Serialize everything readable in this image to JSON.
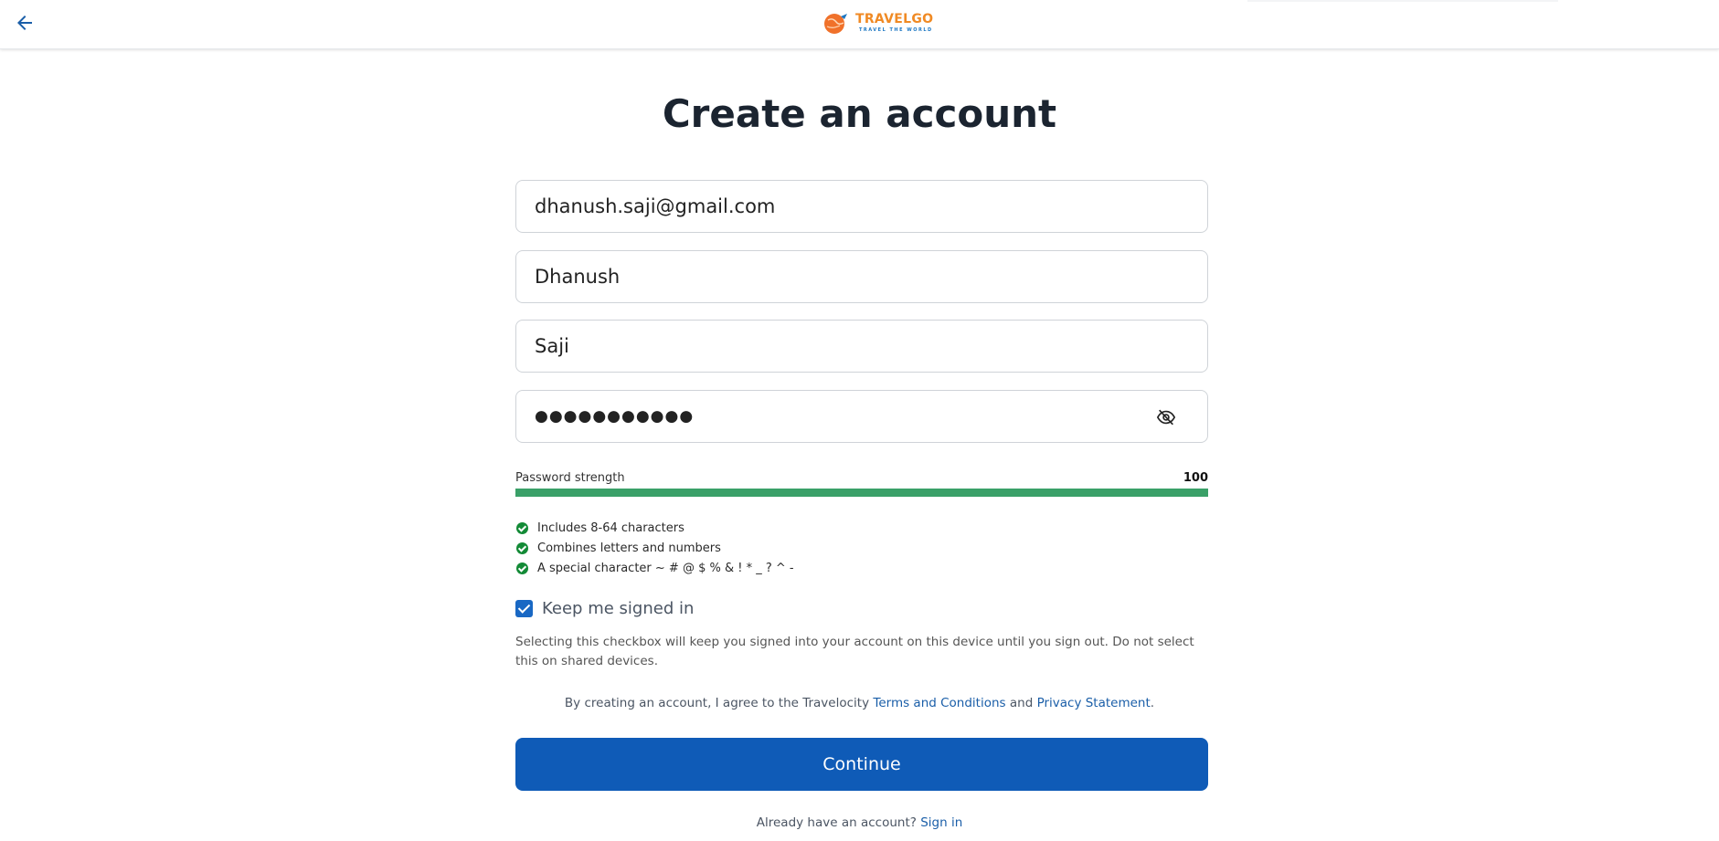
{
  "header": {
    "back_icon": "arrow-left-icon",
    "logo": {
      "name": "TRAVELGO",
      "tagline": "TRAVEL THE WORLD"
    }
  },
  "form": {
    "title": "Create an account",
    "email_value": "dhanush.saji@gmail.com",
    "first_name_value": "Dhanush",
    "last_name_value": "Saji",
    "password_value": "●●●●●●●●●●●",
    "toggle_icon": "eye-off-icon"
  },
  "strength": {
    "label": "Password strength",
    "value": "100",
    "fill_percent": 100,
    "color": "#3aa068"
  },
  "requirements": [
    "Includes 8-64 characters",
    "Combines letters and numbers",
    "A special character ~ # @ $ % & ! * _ ? ^ -"
  ],
  "keep_signed_in": {
    "label": "Keep me signed in",
    "checked": true,
    "description": "Selecting this checkbox will keep you signed into your account on this device until you sign out. Do not select this on shared devices."
  },
  "terms": {
    "prefix": "By creating an account, I agree to the Travelocity ",
    "terms_link": "Terms and Conditions",
    "and": " and ",
    "privacy_link": "Privacy Statement",
    "suffix": "."
  },
  "continue_label": "Continue",
  "signin": {
    "prompt": "Already have an account? ",
    "link": "Sign in"
  },
  "colors": {
    "primary": "#0f5bb7",
    "link": "#1a5ea8",
    "success": "#138a36",
    "logo_orange": "#f08a24"
  }
}
